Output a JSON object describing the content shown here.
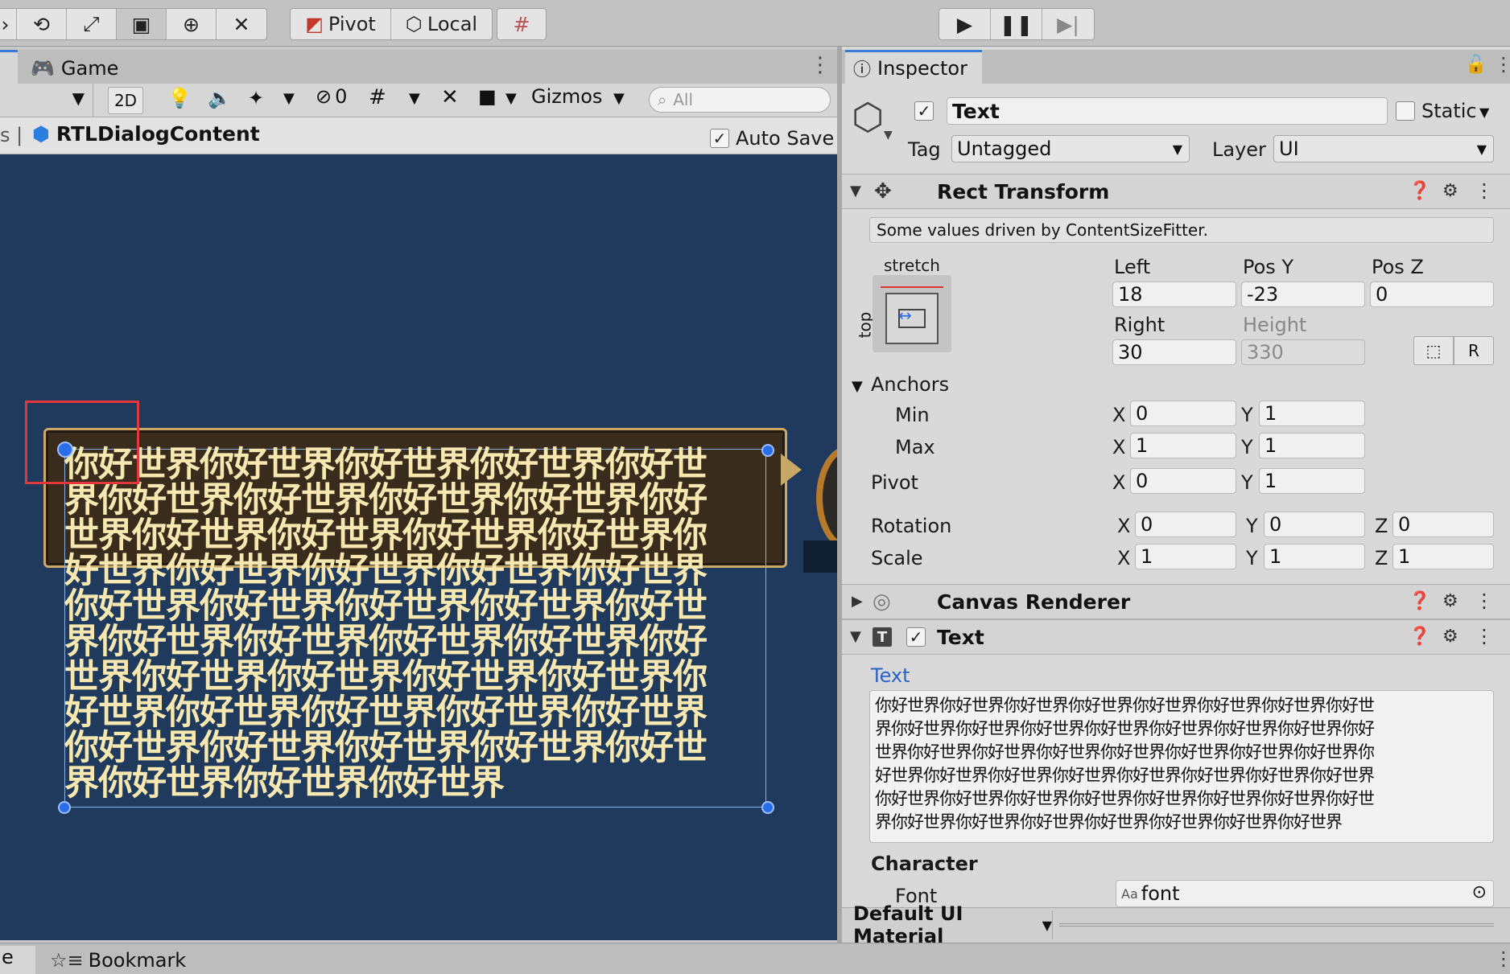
{
  "toolbar": {
    "pivot_label": "Pivot",
    "local_label": "Local",
    "tools": [
      "rotate-tool-icon",
      "scale-tool-icon",
      "rect-tool-icon",
      "transform-tool-icon",
      "custom-tool-icon"
    ]
  },
  "game_tab": {
    "label": "Game"
  },
  "scene_toolbar": {
    "mode_2d": "2D",
    "hidden_count": "0",
    "gizmos_label": "Gizmos",
    "search_placeholder": "All"
  },
  "prefab_bar": {
    "prefab_name": "RTLDialogContent",
    "auto_save_label": "Auto Save",
    "auto_save_checked": true
  },
  "scene_text_lines": [
    "你好世界你好世界你好世界你好世界你好世",
    "界你好世界你好世界你好世界你好世界你好",
    "世界你好世界你好世界你好世界你好世界你",
    "好世界你好世界你好世界你好世界你好世界",
    "你好世界你好世界你好世界你好世界你好世",
    "界你好世界你好世界你好世界你好世界你好",
    "世界你好世界你好世界你好世界你好世界你",
    "好世界你好世界你好世界你好世界你好世界",
    "你好世界你好世界你好世界你好世界你好世",
    "界你好世界你好世界你好世界"
  ],
  "inspector": {
    "tab_label": "Inspector",
    "object_name": "Text",
    "active_checked": true,
    "static_label": "Static",
    "tag_label": "Tag",
    "tag_value": "Untagged",
    "layer_label": "Layer",
    "layer_value": "UI",
    "rect_transform": {
      "title": "Rect Transform",
      "driven_note": "Some values driven by ContentSizeFitter.",
      "anchor_preset_h": "stretch",
      "anchor_preset_v": "top",
      "left_label": "Left",
      "left_value": "18",
      "posy_label": "Pos Y",
      "posy_value": "-23",
      "posz_label": "Pos Z",
      "posz_value": "0",
      "right_label": "Right",
      "right_value": "30",
      "height_label": "Height",
      "height_value": "330",
      "r_button": "R",
      "anchors_label": "Anchors",
      "min_label": "Min",
      "min_x": "0",
      "min_y": "1",
      "max_label": "Max",
      "max_x": "1",
      "max_y": "1",
      "pivot_label": "Pivot",
      "pivot_x": "0",
      "pivot_y": "1",
      "rotation_label": "Rotation",
      "rot_x": "0",
      "rot_y": "0",
      "rot_z": "0",
      "scale_label": "Scale",
      "scale_x": "1",
      "scale_y": "1",
      "scale_z": "1",
      "x_label": "X",
      "y_label": "Y",
      "z_label": "Z"
    },
    "canvas_renderer": {
      "title": "Canvas Renderer"
    },
    "text_component": {
      "title": "Text",
      "enabled": true,
      "text_label": "Text",
      "text_lines": [
        "你好世界你好世界你好世界你好世界你好世界你好世界你好世界你好世",
        "界你好世界你好世界你好世界你好世界你好世界你好世界你好世界你好",
        "世界你好世界你好世界你好世界你好世界你好世界你好世界你好世界你",
        "好世界你好世界你好世界你好世界你好世界你好世界你好世界你好世界",
        "你好世界你好世界你好世界你好世界你好世界你好世界你好世界你好世",
        "界你好世界你好世界你好世界你好世界你好世界你好世界你好世界"
      ],
      "character_label": "Character",
      "font_label": "Font",
      "font_prefix": "Aa",
      "font_value": "font"
    },
    "material_label": "Default UI Material"
  },
  "bottom_bar": {
    "left_fragment": "e",
    "bookmark_label": "Bookmark"
  },
  "colors": {
    "scene_bg": "#1f3a5c",
    "dialog_bg": "#3a2c1c",
    "dialog_text": "#f6e8b0",
    "selection_red": "#e0383b",
    "handle_blue": "#2a6de8",
    "link_blue": "#2a62c8"
  }
}
